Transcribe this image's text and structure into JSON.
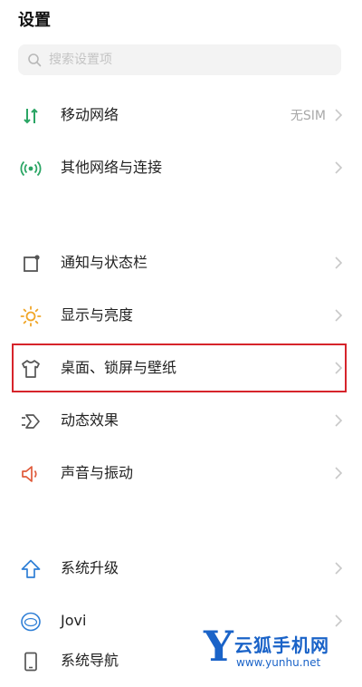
{
  "page_title": "设置",
  "search": {
    "placeholder": "搜索设置项"
  },
  "items": [
    {
      "key": "mobile-network",
      "label": "移动网络",
      "value": "无SIM",
      "icon": "signal-arrows-icon",
      "icon_color": "#2aa564"
    },
    {
      "key": "other-networks",
      "label": "其他网络与连接",
      "value": "",
      "icon": "wireless-icon",
      "icon_color": "#2aa564"
    },
    {
      "key": "notifications",
      "label": "通知与状态栏",
      "value": "",
      "icon": "notification-square-icon",
      "icon_color": "#555555"
    },
    {
      "key": "display",
      "label": "显示与亮度",
      "value": "",
      "icon": "sun-icon",
      "icon_color": "#f0a628"
    },
    {
      "key": "desktop",
      "label": "桌面、锁屏与壁纸",
      "value": "",
      "icon": "shirt-icon",
      "icon_color": "#555555"
    },
    {
      "key": "dynamic-effects",
      "label": "动态效果",
      "value": "",
      "icon": "dynamic-effect-icon",
      "icon_color": "#555555"
    },
    {
      "key": "sound",
      "label": "声音与振动",
      "value": "",
      "icon": "speaker-icon",
      "icon_color": "#e05a3a"
    },
    {
      "key": "system-update",
      "label": "系统升级",
      "value": "",
      "icon": "up-arrow-icon",
      "icon_color": "#2f7fd6"
    },
    {
      "key": "jovi",
      "label": "Jovi",
      "value": "",
      "icon": "jovi-icon",
      "icon_color": "#2f7fd6"
    },
    {
      "key": "system-nav",
      "label": "系统导航",
      "value": "",
      "icon": "phone-icon",
      "icon_color": "#555555"
    }
  ],
  "highlighted_item": "desktop",
  "watermark": {
    "logo_letter": "Y",
    "name": "云狐手机网",
    "url": "www.yunhu.net",
    "color": "#1a63c8"
  }
}
